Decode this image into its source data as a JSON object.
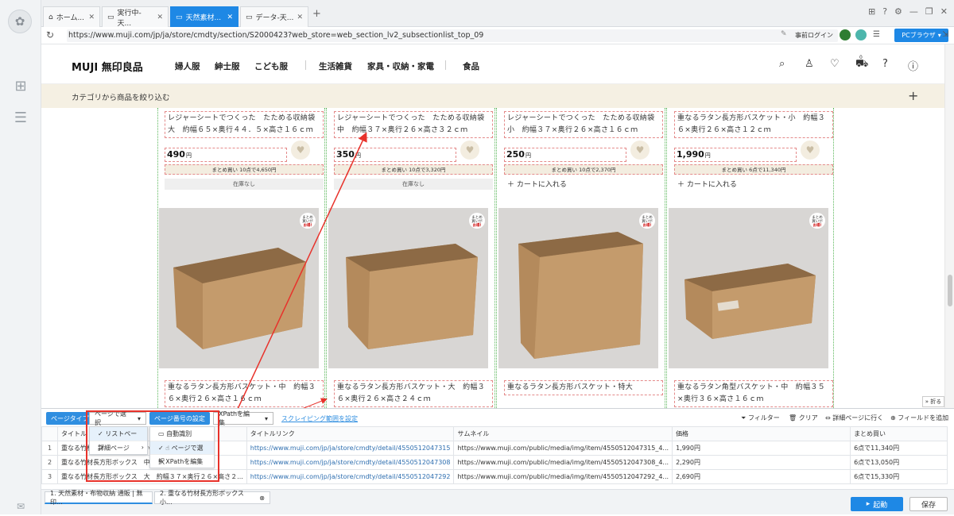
{
  "browser": {
    "tabs": [
      {
        "label": "ホーム..."
      },
      {
        "label": "実行中-天..."
      },
      {
        "label": "天然素材..."
      },
      {
        "label": "データ-天..."
      }
    ],
    "new_tab": "+",
    "url": "https://www.muji.com/jp/ja/store/cmdty/section/S2000423?web_store=web_section_lv2_subsectionlist_top_09",
    "login_label": "事前ログイン",
    "browser_mode": "PCブラウザ"
  },
  "site": {
    "brand": "MUJI 無印良品",
    "menu": [
      "婦人服",
      "紳士服",
      "こども服",
      "生活雑貨",
      "家具・収納・家電",
      "食品"
    ],
    "category_bar": "カテゴリから商品を絞り込む",
    "cart_count": "0",
    "products_top": [
      {
        "name": "レジャーシートでつくった　たためる収納袋 大　約幅６５×奥行４４．５×高さ１６ｃｍ",
        "price": "490",
        "bulk": "まとめ買い 10点で4,650円",
        "stock": "在庫なし"
      },
      {
        "name": "レジャーシートでつくった　たためる収納袋 中　約幅３７×奥行２６×高さ３２ｃｍ",
        "price": "350",
        "bulk": "まとめ買い 10点で3,320円",
        "stock": "在庫なし"
      },
      {
        "name": "レジャーシートでつくった　たためる収納袋 小　約幅３７×奥行２６×高さ１６ｃｍ",
        "price": "250",
        "bulk": "まとめ買い 10点で2,370円",
        "stock": "カートに入れる"
      },
      {
        "name": "重なるラタン長方形バスケット・小　約幅３６×奥行２６×高さ１２ｃｍ",
        "price": "1,990",
        "bulk": "まとめ買い 6点で11,340円",
        "stock": "カートに入れる"
      }
    ],
    "yen": "円",
    "badge_line1": "まとめ",
    "badge_line2": "買いが",
    "badge_line3": "お得!",
    "products_bottom": [
      {
        "name": "重なるラタン長方形バスケット・中　約幅３６×奥行２６×高さ１６ｃｍ"
      },
      {
        "name": "重なるラタン長方形バスケット・大　約幅３６×奥行２６×高さ２４ｃｍ"
      },
      {
        "name": "重なるラタン長方形バスケット・特大"
      },
      {
        "name": "重なるラタン角型バスケット・中　約幅３５×奥行３６×高さ１６ｃｍ"
      }
    ],
    "fold_label": "折る"
  },
  "panel": {
    "page_type_label": "ページタイプ",
    "page_select_value": "ページで選択",
    "page_number_setting": "ページ番号の設定",
    "xpath_select": "XPathを編集",
    "scraping_range_link": "スクレイピング範囲を設定",
    "filter": "フィルター",
    "clear": "クリア",
    "goto_detail": "詳細ページに行く",
    "add_field": "フィールドを追加",
    "dropdown1": [
      "リストページ",
      "詳細ページ"
    ],
    "dropdown2": [
      "自動識別",
      "ページで選択",
      "XPathを編集"
    ],
    "columns": [
      "タイトル",
      "タイトルリンク",
      "サムネイル",
      "価格",
      "まとめ買い"
    ],
    "rows": [
      {
        "num": "1",
        "title": "重なる竹材長方形ボックス　小",
        "link": "https://www.muji.com/jp/ja/store/cmdty/detail/4550512047315",
        "thumb": "https://www.muji.com/public/media/img/item/4550512047315_4...",
        "price": "1,990円",
        "bulk": "6点で11,340円"
      },
      {
        "num": "2",
        "title": "重なる竹材長方形ボックス　中",
        "link": "https://www.muji.com/jp/ja/store/cmdty/detail/4550512047308",
        "thumb": "https://www.muji.com/public/media/img/item/4550512047308_4...",
        "price": "2,290円",
        "bulk": "6点で13,050円"
      },
      {
        "num": "3",
        "title": "重なる竹材長方形ボックス　大　約幅３７×奥行２６×高さ２...",
        "link": "https://www.muji.com/jp/ja/store/cmdty/detail/4550512047292",
        "thumb": "https://www.muji.com/public/media/img/item/4550512047292_4...",
        "price": "2,690円",
        "bulk": "6点で15,330円"
      }
    ]
  },
  "status": {
    "tabs": [
      "1. 天然素材・布物収納 通販 | 無印...",
      "2. 重なる竹材長方形ボックス　小..."
    ],
    "run": "起動",
    "save": "保存"
  },
  "colors": {
    "accent": "#1e88e5",
    "highlight_red": "#e8322b"
  }
}
